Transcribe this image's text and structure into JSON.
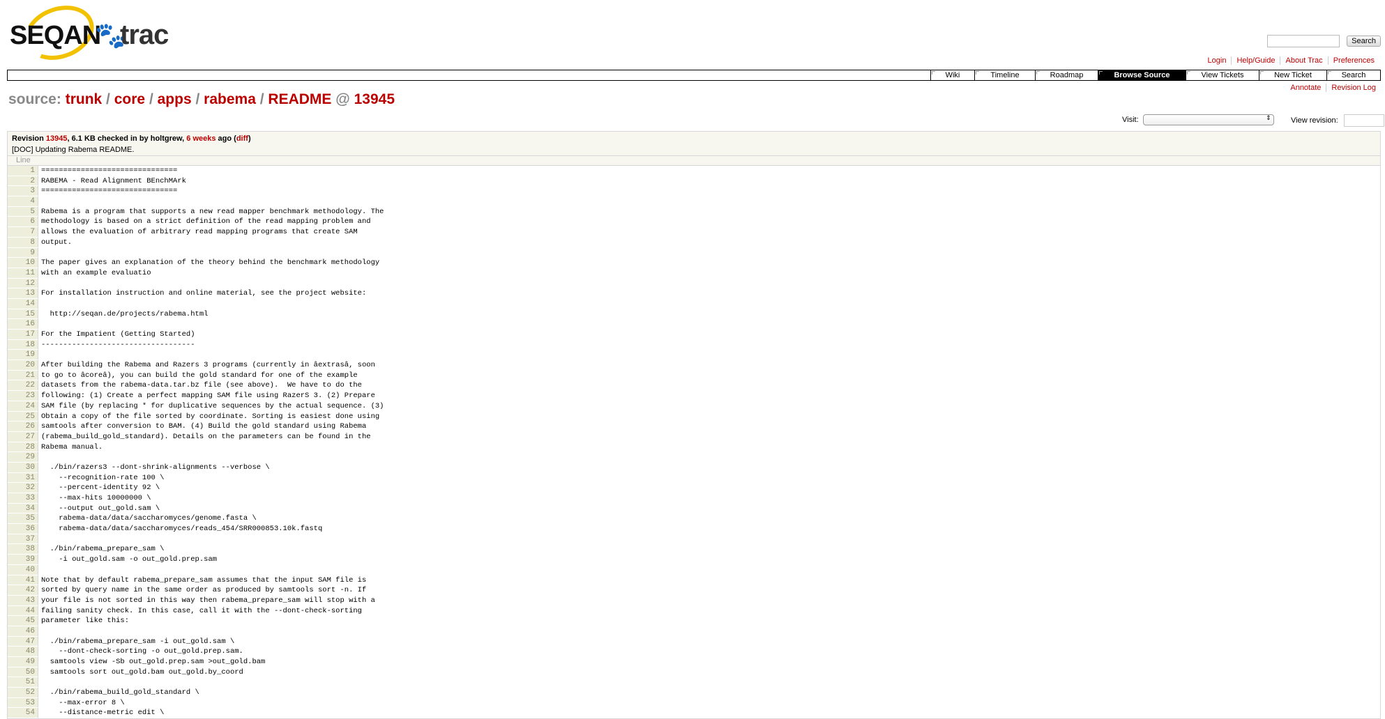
{
  "logo": {
    "seqan": "SEQAN",
    "trac": "trac"
  },
  "search": {
    "button": "Search",
    "value": ""
  },
  "metanav": [
    "Login",
    "Help/Guide",
    "About Trac",
    "Preferences"
  ],
  "mainnav": [
    {
      "label": "Wiki",
      "width": 62
    },
    {
      "label": "Timeline",
      "width": 86
    },
    {
      "label": "Roadmap",
      "width": 89
    },
    {
      "label": "Browse Source",
      "width": 125,
      "active": true
    },
    {
      "label": "View Tickets",
      "width": 104
    },
    {
      "label": "New Ticket",
      "width": 96
    },
    {
      "label": "Search",
      "width": 76
    }
  ],
  "ctxtnav": [
    "Annotate",
    "Revision Log"
  ],
  "path": {
    "prefix": "source:",
    "parts": [
      "trunk",
      "core",
      "apps",
      "rabema",
      "README"
    ],
    "at": "@",
    "rev": "13945"
  },
  "jump": {
    "label": "Visit:",
    "value": ""
  },
  "view_revision": {
    "label": "View revision:",
    "value": ""
  },
  "info": {
    "revision_label": "Revision",
    "rev": "13945",
    "size_text": ", 6.1 KB checked in by holtgrew,",
    "age": "6 weeks",
    "ago": "ago (",
    "diff": "diff",
    "close": ")",
    "message": "[DOC] Updating Rabema README."
  },
  "code": {
    "header": "Line",
    "lines": [
      "===============================",
      "RABEMA - Read Alignment BEnchMArk",
      "===============================",
      "",
      "Rabema is a program that supports a new read mapper benchmark methodology. The",
      "methodology is based on a strict definition of the read mapping problem and",
      "allows the evaluation of arbitrary read mapping programs that create SAM",
      "output.",
      "",
      "The paper gives an explanation of the theory behind the benchmark methodology",
      "with an example evaluatio",
      "",
      "For installation instruction and online material, see the project website:",
      "",
      "  http://seqan.de/projects/rabema.html",
      "",
      "For the Impatient (Getting Started)",
      "-----------------------------------",
      "",
      "After building the Rabema and Razers 3 programs (currently in âextrasâ, soon",
      "to go to âcoreâ), you can build the gold standard for one of the example",
      "datasets from the rabema-data.tar.bz file (see above).  We have to do the",
      "following: (1) Create a perfect mapping SAM file using RazerS 3. (2) Prepare",
      "SAM file (by replacing * for duplicative sequences by the actual sequence. (3)",
      "Obtain a copy of the file sorted by coordinate. Sorting is easiest done using",
      "samtools after conversion to BAM. (4) Build the gold standard using Rabema",
      "(rabema_build_gold_standard). Details on the parameters can be found in the",
      "Rabema manual.",
      "",
      "  ./bin/razers3 --dont-shrink-alignments --verbose \\",
      "    --recognition-rate 100 \\",
      "    --percent-identity 92 \\",
      "    --max-hits 10000000 \\",
      "    --output out_gold.sam \\",
      "    rabema-data/data/saccharomyces/genome.fasta \\",
      "    rabema-data/data/saccharomyces/reads_454/SRR000853.10k.fastq",
      "",
      "  ./bin/rabema_prepare_sam \\",
      "    -i out_gold.sam -o out_gold.prep.sam",
      "",
      "Note that by default rabema_prepare_sam assumes that the input SAM file is",
      "sorted by query name in the same order as produced by samtools sort -n. If",
      "your file is not sorted in this way then rabema_prepare_sam will stop with a",
      "failing sanity check. In this case, call it with the --dont-check-sorting",
      "parameter like this:",
      "",
      "  ./bin/rabema_prepare_sam -i out_gold.sam \\",
      "    --dont-check-sorting -o out_gold.prep.sam.",
      "  samtools view -Sb out_gold.prep.sam >out_gold.bam",
      "  samtools sort out_gold.bam out_gold.by_coord",
      "",
      "  ./bin/rabema_build_gold_standard \\",
      "    --max-error 8 \\",
      "    --distance-metric edit \\"
    ]
  }
}
